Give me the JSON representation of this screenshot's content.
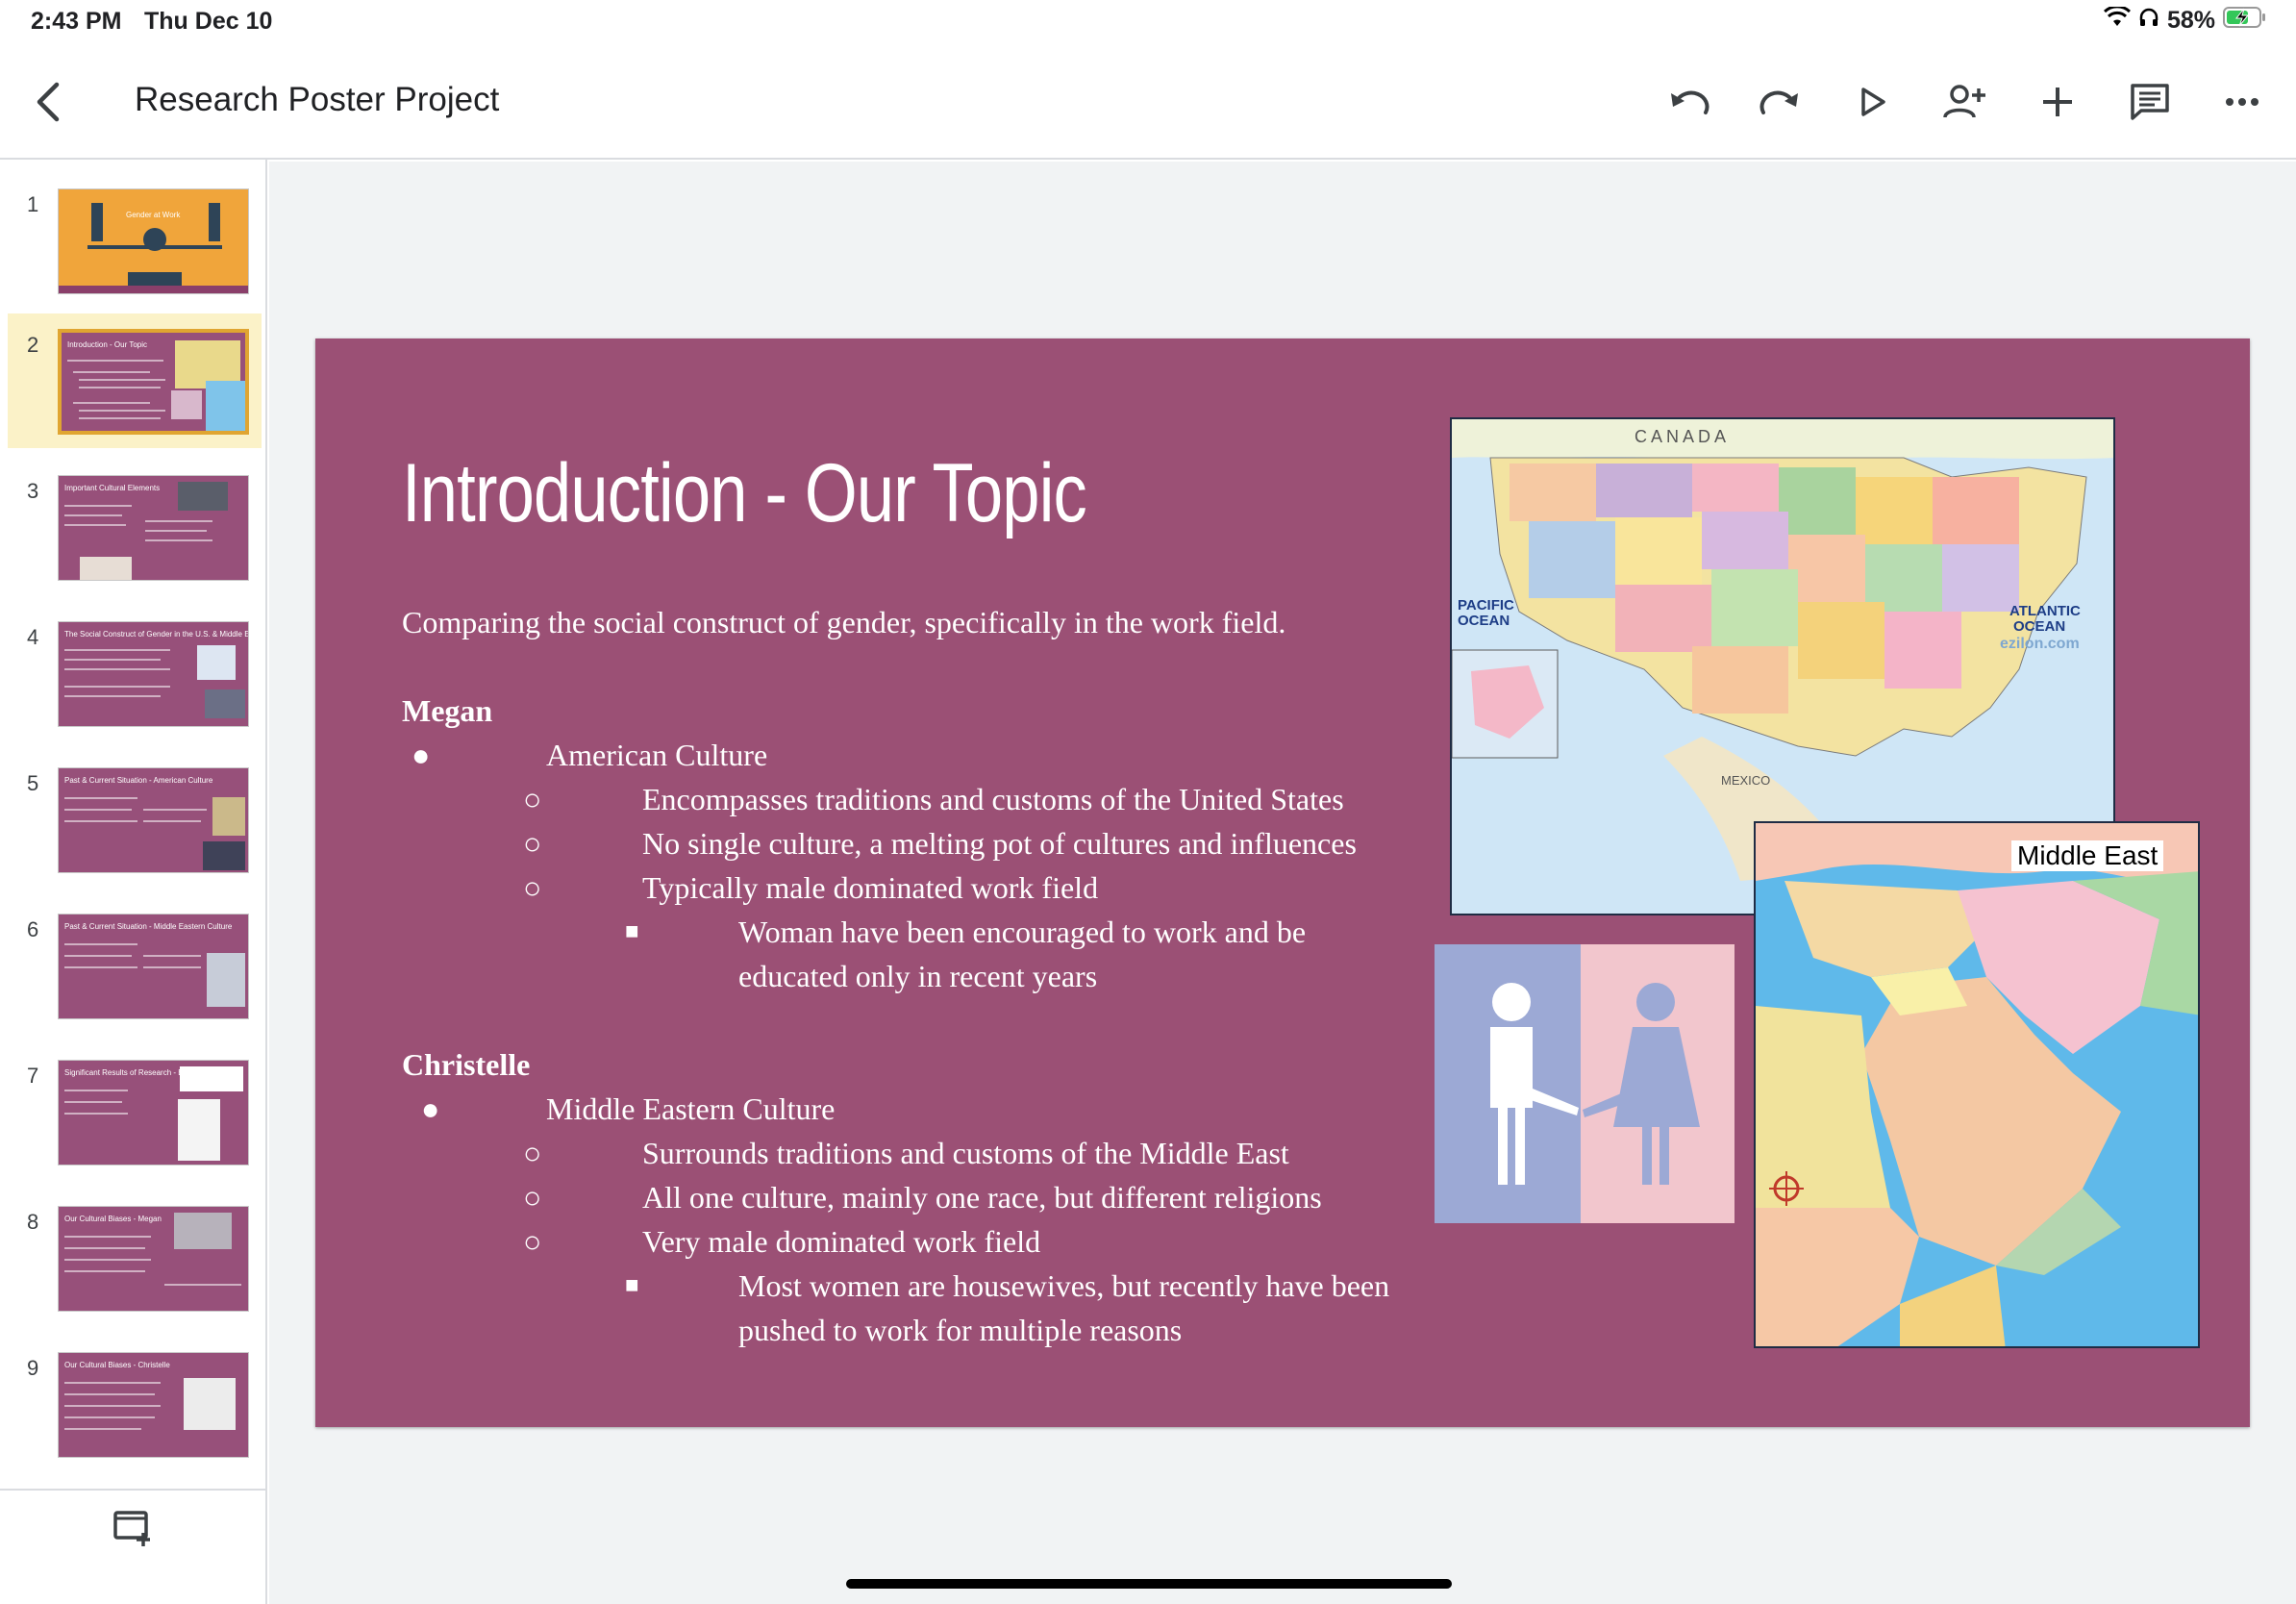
{
  "status": {
    "time": "2:43 PM",
    "date": "Thu Dec 10",
    "battery": "58%"
  },
  "toolbar": {
    "title": "Research Poster Project",
    "buttons": [
      "undo",
      "redo",
      "present",
      "share",
      "insert",
      "comments",
      "more"
    ]
  },
  "filmstrip": {
    "slides": [
      {
        "number": "1",
        "title": "Gender at Work"
      },
      {
        "number": "2",
        "title": "Introduction - Our Topic"
      },
      {
        "number": "3",
        "title": "Important Cultural Elements"
      },
      {
        "number": "4",
        "title": "The Social Construct of Gender in the U.S. & Middle East"
      },
      {
        "number": "5",
        "title": "Past & Current Situation - American Culture"
      },
      {
        "number": "6",
        "title": "Past & Current Situation - Middle Eastern Culture"
      },
      {
        "number": "7",
        "title": "Significant Results of Research - Both"
      },
      {
        "number": "8",
        "title": "Our Cultural Biases - Megan"
      },
      {
        "number": "9",
        "title": "Our Cultural Biases - Christelle"
      }
    ],
    "selected_index": 2
  },
  "slide": {
    "title": "Introduction - Our Topic",
    "intro": "Comparing the social construct of gender, specifically in the work field.",
    "megan": {
      "name": "Megan",
      "bullet": "American Culture",
      "sub": [
        "Encompasses traditions and customs of the United States",
        "No single culture, a melting pot of cultures and influences",
        "Typically male dominated work field"
      ],
      "subsub": [
        "Woman have been encouraged to work and be",
        "educated only in recent years"
      ]
    },
    "christelle": {
      "name": "Christelle",
      "bullet": "Middle Eastern Culture",
      "sub": [
        "Surrounds traditions and customs of the Middle East",
        "All one culture, mainly one race, but different religions",
        "Very male dominated work field"
      ],
      "subsub": [
        "Most women are housewives, but recently have been",
        "pushed to work for multiple reasons"
      ]
    },
    "bullet_glyphs": {
      "l1": "●",
      "l2": "○",
      "l3": "■"
    },
    "map_us_labels": {
      "canada": "C A N A D A",
      "pacific": "PACIFIC\nOCEAN",
      "atlantic": "ATLANTIC\nOCEAN",
      "mexico": "MEXICO",
      "watermark": "ezilon.com"
    },
    "map_me_label": "Middle East",
    "colors": {
      "slide_bg": "#9b5075",
      "selected_border": "#e0a531",
      "selected_row": "#fbf2c8"
    }
  }
}
